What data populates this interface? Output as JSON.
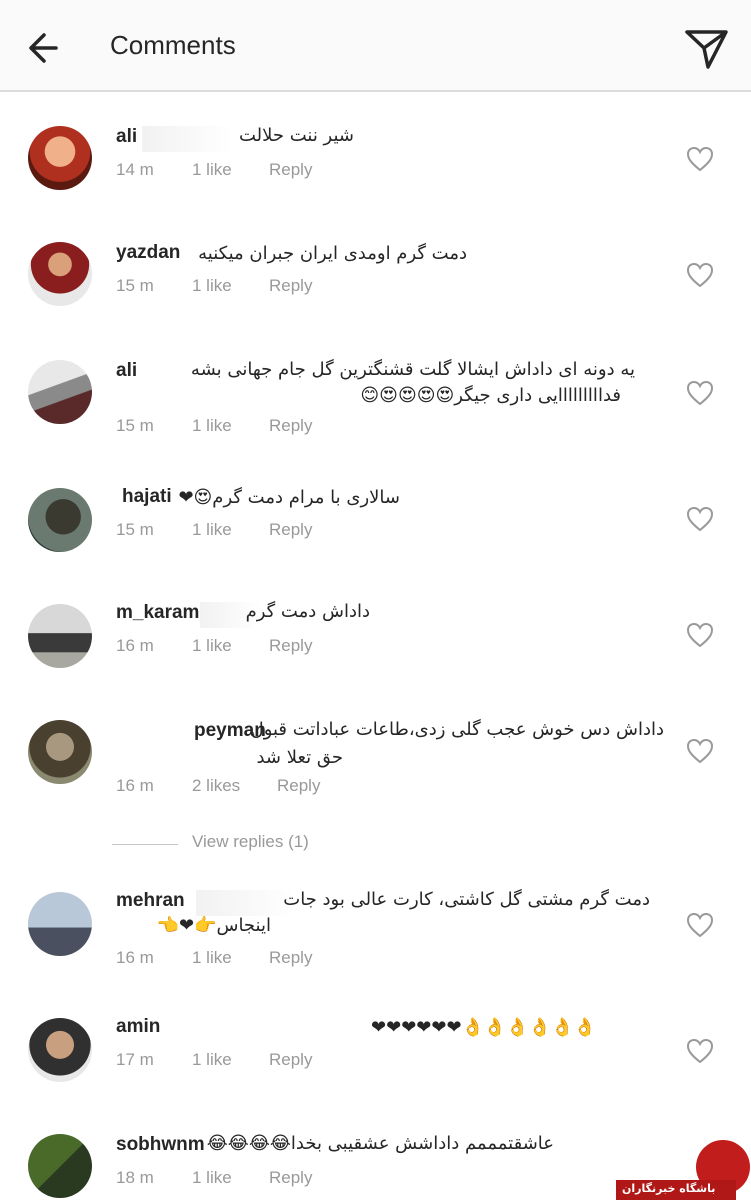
{
  "header": {
    "title": "Comments"
  },
  "comments": [
    {
      "username": "ali",
      "text": "شیر ننت حلالت",
      "time": "14 m",
      "likes": "1 like",
      "reply": "Reply"
    },
    {
      "username": "yazdan",
      "text": "دمت گرم اومدی ایران جبران میکنیه",
      "time": "15 m",
      "likes": "1 like",
      "reply": "Reply"
    },
    {
      "username": "ali",
      "text_line1": "یه دونه ای داداش ایشالا گلت قشنگترین گل جام جهانی بشه",
      "text_line2": "فدااااااااایی داری جیگر😍😍😍😍😊",
      "time": "15 m",
      "likes": "1 like",
      "reply": "Reply"
    },
    {
      "username": "hajati",
      "text": "سالاری با مرام دمت گرم😍❤",
      "time": "15 m",
      "likes": "1 like",
      "reply": "Reply"
    },
    {
      "username": "m_karam",
      "text": "داداش دمت گرم",
      "time": "16 m",
      "likes": "1 like",
      "reply": "Reply"
    },
    {
      "username": "peyman",
      "text_line1": "داداش دس خوش عجب گلی زدی،طاعات عباداتت قبول",
      "text_line2": "حق تعلا شد",
      "time": "16 m",
      "likes": "2 likes",
      "reply": "Reply"
    },
    {
      "username": "mehran",
      "text_line1": "دمت گرم مشتی گل کاشتی، کارت عالی بود جات",
      "text_line2": "اینجاس👉❤👈",
      "time": "16 m",
      "likes": "1 like",
      "reply": "Reply"
    },
    {
      "username": "amin",
      "text": "👌👌👌👌👌👌❤❤❤❤❤❤",
      "time": "17 m",
      "likes": "1 like",
      "reply": "Reply"
    },
    {
      "username": "sobhwnm",
      "text": "عاشقتمممم داداشش عشقیبی بخدا😂😂😂😂",
      "time": "18 m",
      "likes": "1 like",
      "reply": "Reply"
    }
  ],
  "view_replies": "View replies (1)",
  "watermark": "باشگاه خبرنگاران",
  "colors": {
    "accent": "#262626",
    "muted": "#999999",
    "watermark": "#c21d1d"
  }
}
